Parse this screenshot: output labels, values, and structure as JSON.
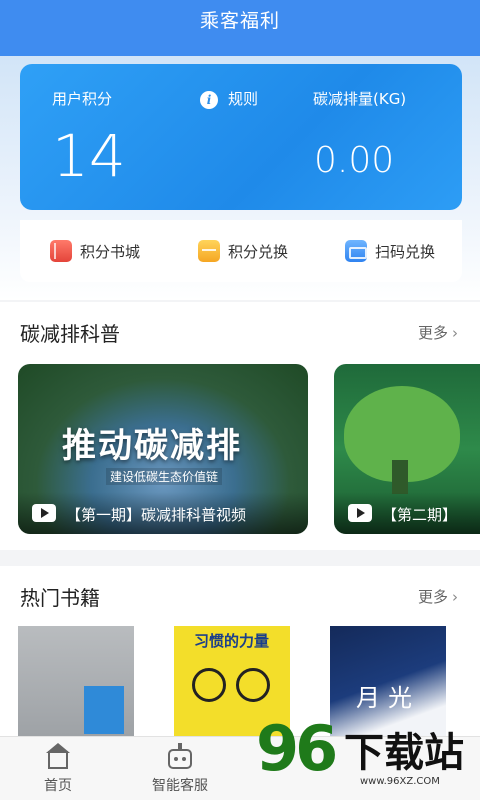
{
  "header": {
    "title": "乘客福利"
  },
  "points_card": {
    "points_label": "用户积分",
    "points_value": "14",
    "rules_label": "规则",
    "carbon_label": "碳减排量(KG)",
    "carbon_value": "0.00"
  },
  "shortcuts": [
    {
      "label": "积分书城",
      "icon": "book-icon"
    },
    {
      "label": "积分兑换",
      "icon": "gift-icon"
    },
    {
      "label": "扫码兑换",
      "icon": "scan-icon"
    }
  ],
  "science": {
    "title": "碳减排科普",
    "more_label": "更多",
    "videos": [
      {
        "headline": "推动碳减排",
        "subtitle": "建设低碳生态价值链",
        "caption": "【第一期】碳减排科普视频"
      },
      {
        "caption": "【第二期】"
      }
    ]
  },
  "books": {
    "title": "热门书籍",
    "more_label": "更多",
    "items": [
      {
        "cover_title": ""
      },
      {
        "cover_title": "习惯的力量"
      },
      {
        "cover_title": "月光"
      }
    ]
  },
  "tabbar": {
    "items": [
      {
        "label": "首页",
        "icon": "home-icon"
      },
      {
        "label": "智能客服",
        "icon": "robot-icon"
      }
    ]
  },
  "watermark": {
    "number": "96",
    "text": "下载站",
    "url": "www.96XZ.COM"
  },
  "colors": {
    "header": "#3f8cf0",
    "card": "#2196f0",
    "watermark_green": "#1f7a1a"
  }
}
